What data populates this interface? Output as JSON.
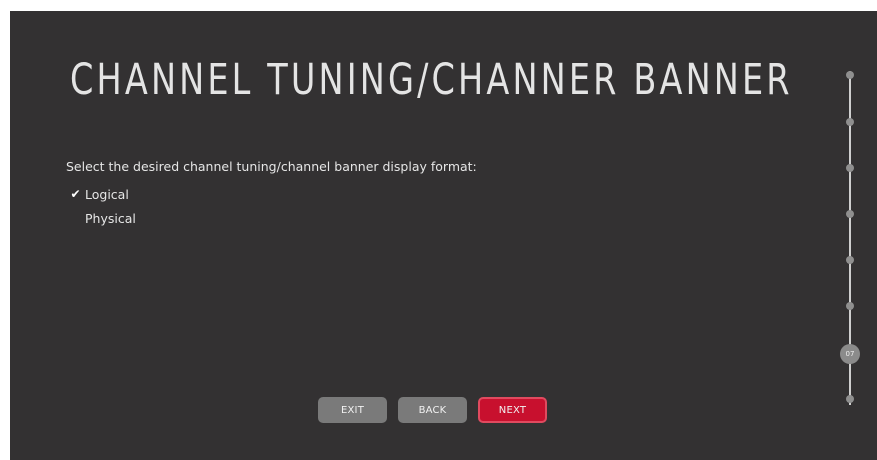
{
  "page": {
    "title": "CHANNEL TUNING/CHANNER BANNER",
    "prompt": "Select the desired channel tuning/channel banner display format:"
  },
  "options": [
    {
      "label": "Logical",
      "selected": true,
      "check_glyph": "✔"
    },
    {
      "label": "Physical",
      "selected": false,
      "check_glyph": "✔"
    }
  ],
  "buttons": {
    "exit_label": "EXIT",
    "back_label": "BACK",
    "next_label": "NEXT"
  },
  "progress": {
    "current_step_label": "07"
  },
  "colors": {
    "background": "#333132",
    "accent": "#c8102e",
    "button_gray": "#7a7a7a"
  },
  "icons": {
    "selected_marker": "checkmark-icon"
  }
}
